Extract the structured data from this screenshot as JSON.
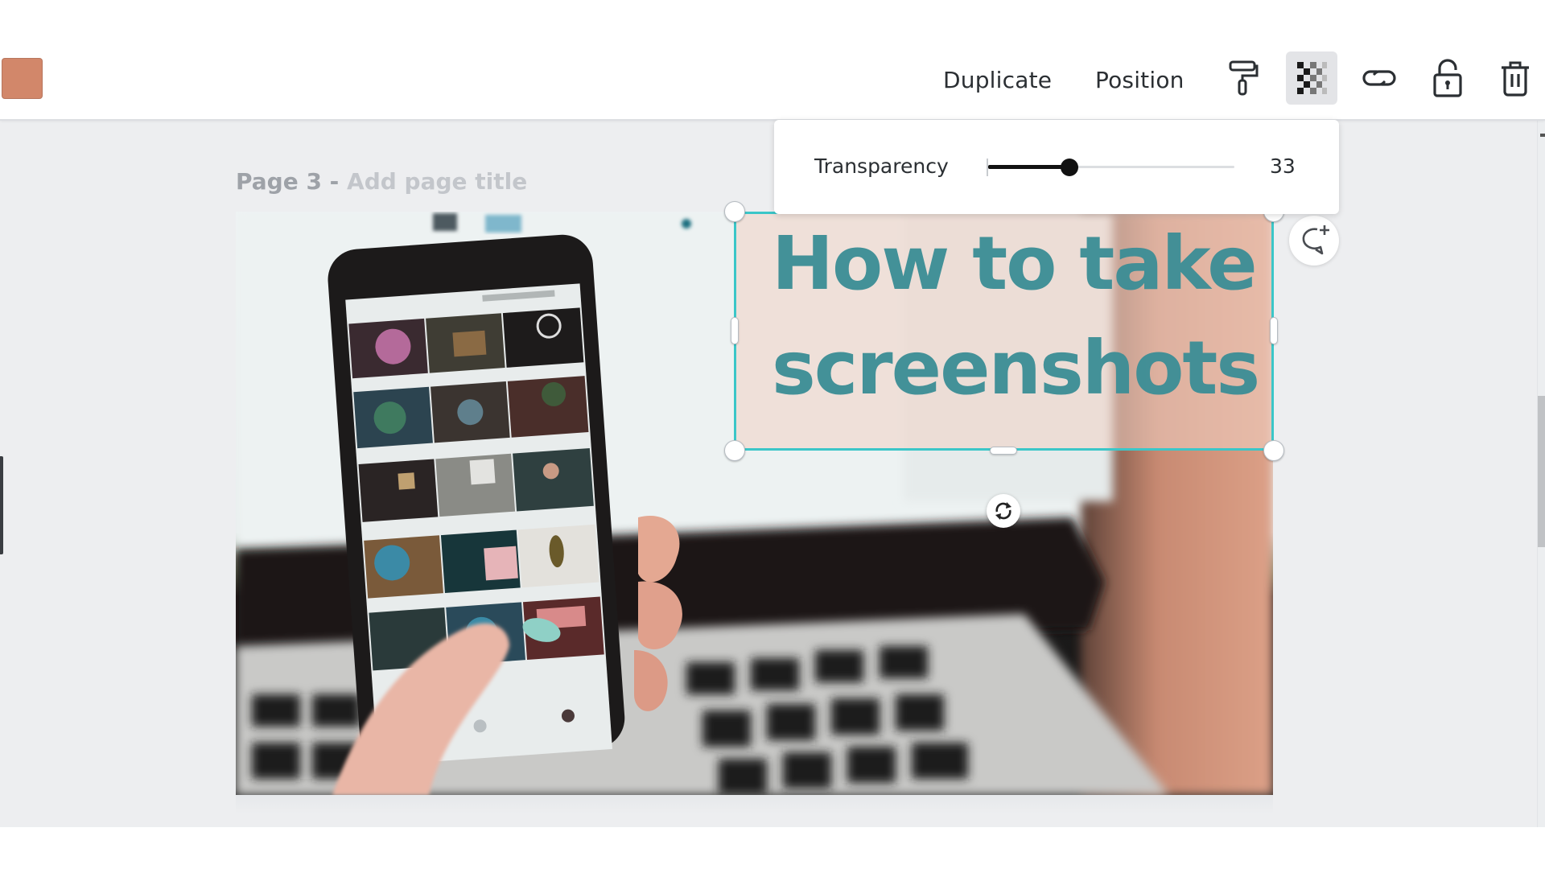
{
  "toolbar": {
    "color_swatch": {
      "color": "#D2876A",
      "label": "text-color"
    },
    "duplicate_label": "Duplicate",
    "position_label": "Position",
    "icons": [
      {
        "name": "paint-roller-icon",
        "label": "Copy style",
        "active": false
      },
      {
        "name": "transparency-icon",
        "label": "Transparency",
        "active": true
      },
      {
        "name": "link-icon",
        "label": "Link",
        "active": false
      },
      {
        "name": "unlock-icon",
        "label": "Lock",
        "active": false
      },
      {
        "name": "trash-icon",
        "label": "Delete",
        "active": false
      }
    ]
  },
  "transparency_popover": {
    "label": "Transparency",
    "value": 33,
    "value_text": "33",
    "min": 0,
    "max": 100
  },
  "page": {
    "number_label": "Page 3 -",
    "title_placeholder": "Add page title"
  },
  "design": {
    "heading_line1": "How to take",
    "heading_line2": "screenshots",
    "heading_color": "#3D8E96",
    "selection_color": "#3BC6C8",
    "photo_description": "hand holding smartphone showing photo grid in front of blurred laptop"
  },
  "controls": {
    "rotate_icon": "rotate-icon",
    "comment_icon": "add-comment-icon"
  }
}
